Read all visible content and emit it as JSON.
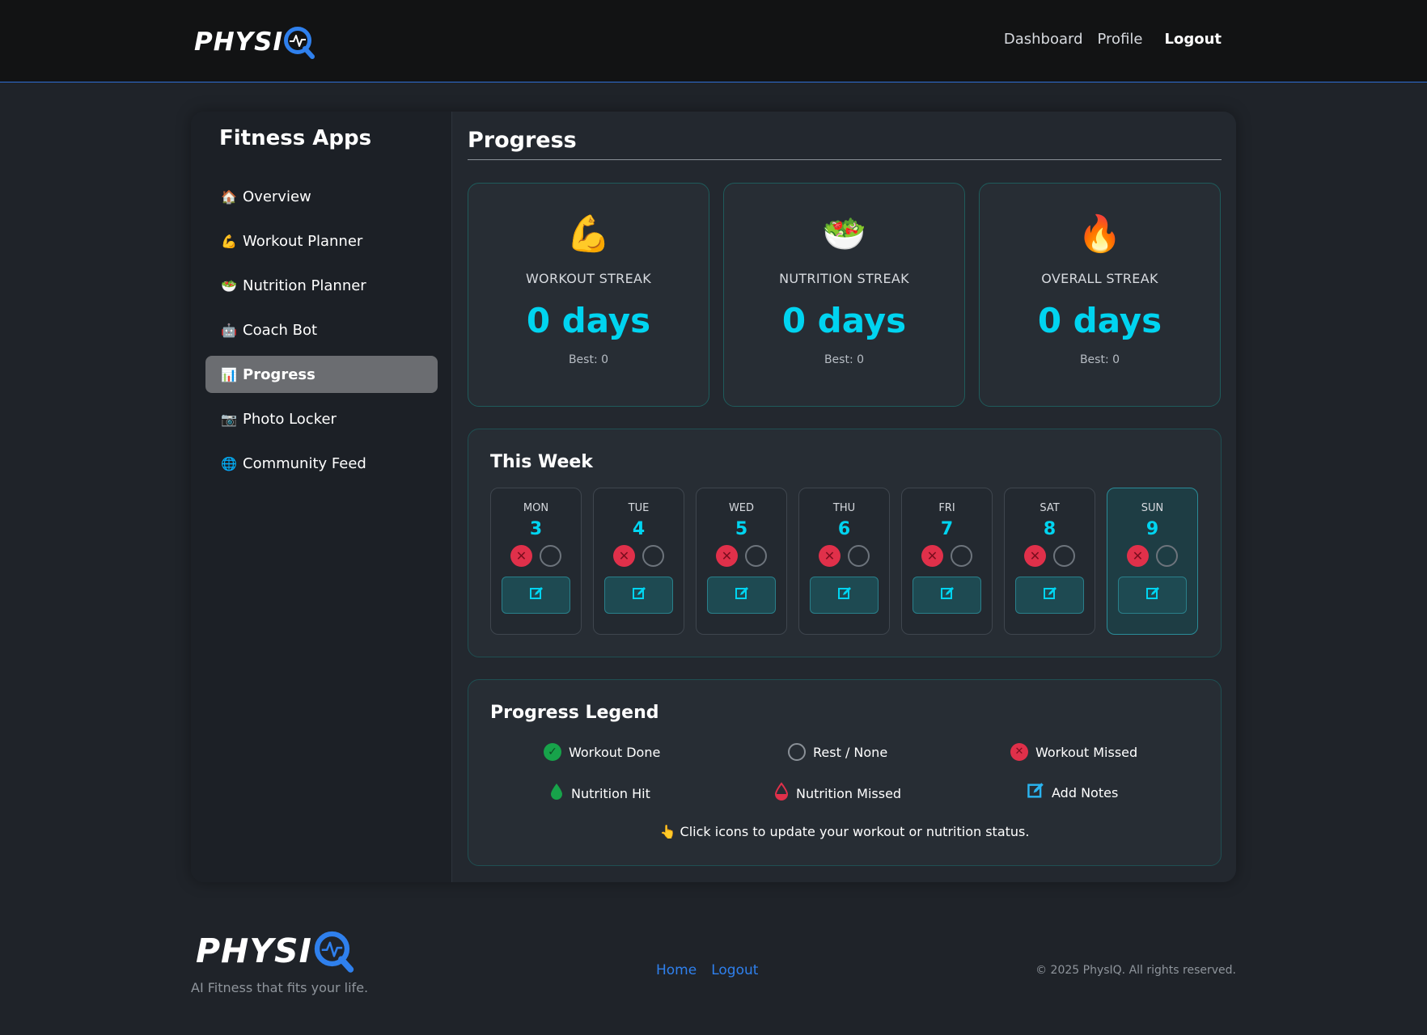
{
  "brand": {
    "logo_text": "PHYSI",
    "logo_letter": "Q",
    "accent_color": "#2f80ed",
    "tagline": "AI Fitness that fits your life."
  },
  "nav": {
    "dashboard": "Dashboard",
    "profile": "Profile",
    "logout": "Logout"
  },
  "sidebar": {
    "title": "Fitness Apps",
    "items": [
      {
        "label": "Overview",
        "icon": "house-icon",
        "glyph": "🏠",
        "active": false
      },
      {
        "label": "Workout Planner",
        "icon": "flexed-bicep-icon",
        "glyph": "💪",
        "active": false
      },
      {
        "label": "Nutrition Planner",
        "icon": "salad-bowl-icon",
        "glyph": "🥗",
        "active": false
      },
      {
        "label": "Coach Bot",
        "icon": "robot-icon",
        "glyph": "🤖",
        "active": false
      },
      {
        "label": "Progress",
        "icon": "bar-chart-icon",
        "glyph": "📊",
        "active": true
      },
      {
        "label": "Photo Locker",
        "icon": "camera-icon",
        "glyph": "📷",
        "active": false
      },
      {
        "label": "Community Feed",
        "icon": "globe-icon",
        "glyph": "🌐",
        "active": false
      }
    ]
  },
  "main": {
    "title": "Progress",
    "streaks": [
      {
        "icon": "flexed-bicep-icon",
        "glyph": "💪",
        "label": "WORKOUT STREAK",
        "value": "0 days",
        "best": "Best: 0"
      },
      {
        "icon": "salad-bowl-icon",
        "glyph": "🥗",
        "label": "NUTRITION STREAK",
        "value": "0 days",
        "best": "Best: 0"
      },
      {
        "icon": "fire-icon",
        "glyph": "🔥",
        "label": "OVERALL STREAK",
        "value": "0 days",
        "best": "Best: 0"
      }
    ],
    "week": {
      "title": "This Week",
      "days": [
        {
          "name": "MON",
          "num": "3",
          "workout": "missed",
          "nutrition": "none",
          "today": false
        },
        {
          "name": "TUE",
          "num": "4",
          "workout": "missed",
          "nutrition": "none",
          "today": false
        },
        {
          "name": "WED",
          "num": "5",
          "workout": "missed",
          "nutrition": "none",
          "today": false
        },
        {
          "name": "THU",
          "num": "6",
          "workout": "missed",
          "nutrition": "none",
          "today": false
        },
        {
          "name": "FRI",
          "num": "7",
          "workout": "missed",
          "nutrition": "none",
          "today": false
        },
        {
          "name": "SAT",
          "num": "8",
          "workout": "missed",
          "nutrition": "none",
          "today": false
        },
        {
          "name": "SUN",
          "num": "9",
          "workout": "missed",
          "nutrition": "none",
          "today": true
        }
      ]
    },
    "legend": {
      "title": "Progress Legend",
      "items": [
        {
          "label": "Workout Done",
          "icon": "check-circle-icon"
        },
        {
          "label": "Rest / None",
          "icon": "empty-circle-icon"
        },
        {
          "label": "Workout Missed",
          "icon": "x-circle-icon"
        },
        {
          "label": "Nutrition Hit",
          "icon": "green-drop-icon"
        },
        {
          "label": "Nutrition Missed",
          "icon": "red-drop-icon"
        },
        {
          "label": "Add Notes",
          "icon": "edit-note-icon"
        }
      ],
      "hint": "Click icons to update your workout or nutrition status."
    }
  },
  "footer": {
    "links": [
      "Home",
      "Logout"
    ],
    "copyright": "© 2025 PhysIQ. All rights reserved."
  },
  "colors": {
    "cyan": "#00d4f0",
    "missed": "#e0304a",
    "done": "#17a34a",
    "background": "#1f2329"
  }
}
